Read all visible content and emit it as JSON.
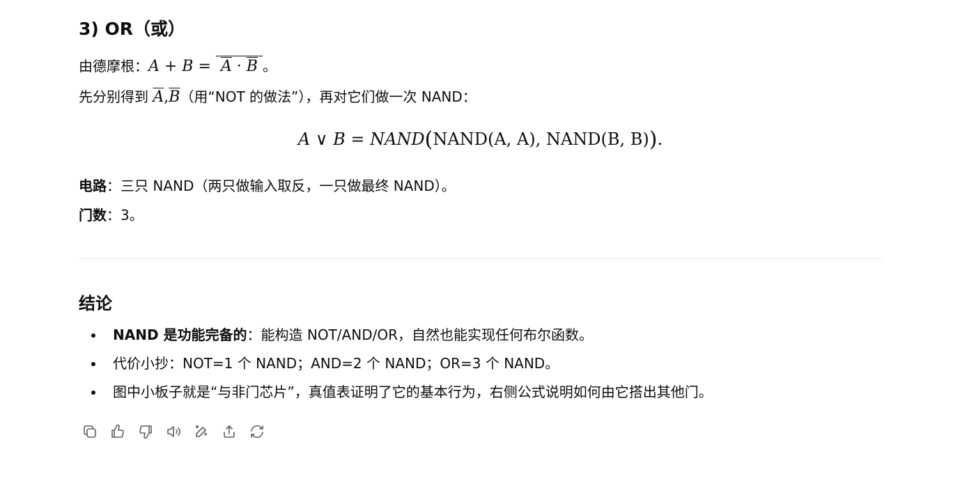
{
  "section_or": {
    "heading": "3) OR（或）",
    "demorgan_prefix": "由德摩根：",
    "demorgan_lhs": "A + B =",
    "demorgan_bar_a": "A",
    "demorgan_dot": "·",
    "demorgan_bar_b": "B",
    "demorgan_suffix": "。",
    "step_prefix": "先分别得到",
    "step_bar_a": "A",
    "step_comma": ",",
    "step_bar_b": "B",
    "step_suffix": "（用“NOT 的做法”），再对它们做一次 NAND：",
    "formula_lhs": "A ∨ B = NAND",
    "formula_inner_1": "NAND(A, A),",
    "formula_inner_2": "NAND(B, B)",
    "formula_end": ".",
    "circuit_label": "电路",
    "circuit_text": "：三只 NAND（两只做输入取反，一只做最终 NAND）。",
    "gates_label": "门数",
    "gates_text": "：3。"
  },
  "conclusion": {
    "heading": "结论",
    "bullets": [
      {
        "bold": "NAND 是功能完备的",
        "text": "：能构造 NOT/AND/OR，自然也能实现任何布尔函数。"
      },
      {
        "bold": "",
        "text": "代价小抄：NOT=1 个 NAND；AND=2 个 NAND；OR=3 个 NAND。"
      },
      {
        "bold": "",
        "text": "图中小板子就是“与非门芯片”，真值表证明了它的基本行为，右侧公式说明如何由它搭出其他门。"
      }
    ]
  },
  "toolbar": {
    "icons": [
      "copy-icon",
      "thumbs-up-icon",
      "thumbs-down-icon",
      "read-aloud-icon",
      "edit-icon",
      "share-icon",
      "regenerate-icon"
    ]
  }
}
